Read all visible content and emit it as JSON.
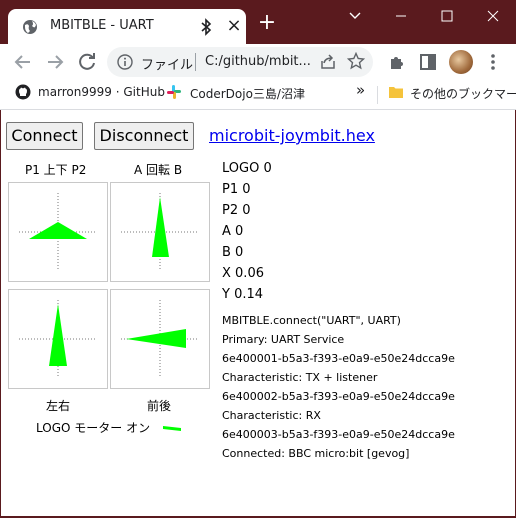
{
  "browser": {
    "tab_title": "MBITBLE - UART",
    "tab_close": "×",
    "new_tab": "+",
    "omnibox_label": "ファイル",
    "omnibox_url": "C:/github/mbit...",
    "bookmarks": [
      {
        "label": "marron9999 · GitHub",
        "icon": "github-icon"
      },
      {
        "label": "CoderDojo三島/沼津",
        "icon": "slack-icon"
      }
    ],
    "bookmarks_more": "»",
    "other_bookmarks": "その他のブックマーク"
  },
  "app": {
    "connect_label": "Connect",
    "disconnect_label": "Disconnect",
    "hex_link": "microbit-joymbit.hex",
    "header_left": "P1 上下 P2",
    "header_right": "A 回転 B",
    "footer_left": "左右",
    "footer_right": "前後",
    "motor_label": "LOGO モーター オン",
    "accent_color": "#00ff00",
    "stats": [
      {
        "name": "LOGO",
        "value": "0",
        "text": "LOGO 0"
      },
      {
        "name": "P1",
        "value": "0",
        "text": "P1 0"
      },
      {
        "name": "P2",
        "value": "0",
        "text": "P2 0"
      },
      {
        "name": "A",
        "value": "0",
        "text": "A 0"
      },
      {
        "name": "B",
        "value": "0",
        "text": "B 0"
      },
      {
        "name": "X",
        "value": "0.06",
        "text": "X 0.06"
      },
      {
        "name": "Y",
        "value": "0.14",
        "text": "Y 0.14"
      }
    ],
    "log": [
      "MBITBLE.connect(\"UART\", UART)",
      "Primary: UART Service",
      "6e400001-b5a3-f393-e0a9-e50e24dcca9e",
      "Characteristic: TX + listener",
      "6e400002-b5a3-f393-e0a9-e50e24dcca9e",
      "Characteristic: RX",
      "6e400003-b5a3-f393-e0a9-e50e24dcca9e",
      "Connected: BBC micro:bit [gevog]"
    ]
  }
}
